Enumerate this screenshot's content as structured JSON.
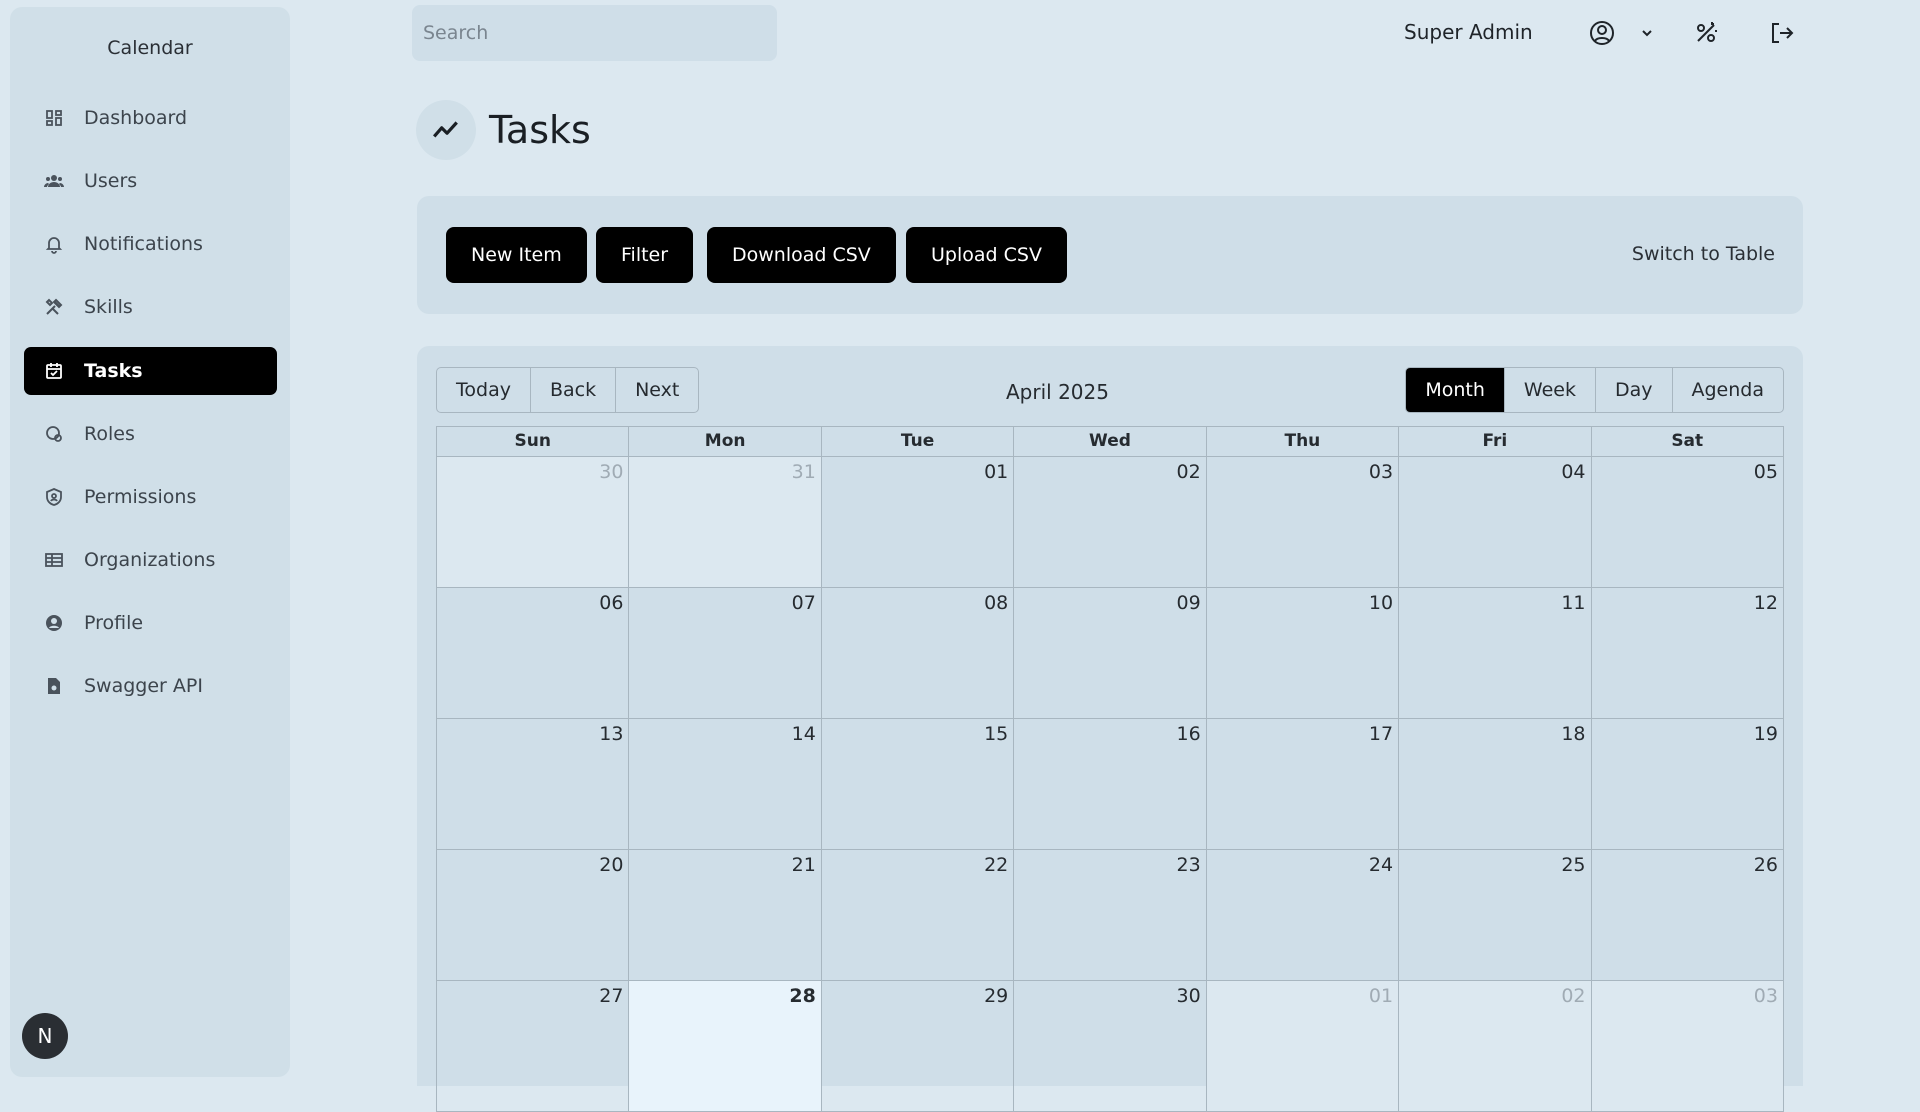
{
  "sidebar": {
    "title": "Calendar",
    "items": [
      {
        "label": "Dashboard",
        "icon": "dashboard-icon"
      },
      {
        "label": "Users",
        "icon": "users-icon"
      },
      {
        "label": "Notifications",
        "icon": "bell-icon"
      },
      {
        "label": "Skills",
        "icon": "tools-icon"
      },
      {
        "label": "Tasks",
        "icon": "calendar-check-icon",
        "active": true
      },
      {
        "label": "Roles",
        "icon": "roles-icon"
      },
      {
        "label": "Permissions",
        "icon": "shield-icon"
      },
      {
        "label": "Organizations",
        "icon": "table-icon"
      },
      {
        "label": "Profile",
        "icon": "user-circle-icon"
      },
      {
        "label": "Swagger API",
        "icon": "file-icon"
      }
    ],
    "avatar_letter": "N"
  },
  "header": {
    "search_placeholder": "Search",
    "user_name": "Super Admin"
  },
  "page": {
    "title": "Tasks"
  },
  "toolbar": {
    "new_item": "New Item",
    "filter": "Filter",
    "download_csv": "Download CSV",
    "upload_csv": "Upload CSV",
    "switch_view": "Switch to Table"
  },
  "calendar": {
    "nav": {
      "today": "Today",
      "back": "Back",
      "next": "Next"
    },
    "label": "April 2025",
    "views": {
      "month": "Month",
      "week": "Week",
      "day": "Day",
      "agenda": "Agenda"
    },
    "active_view": "month",
    "weekdays": [
      "Sun",
      "Mon",
      "Tue",
      "Wed",
      "Thu",
      "Fri",
      "Sat"
    ],
    "weeks": [
      [
        {
          "d": "30",
          "off": true
        },
        {
          "d": "31",
          "off": true
        },
        {
          "d": "01"
        },
        {
          "d": "02"
        },
        {
          "d": "03"
        },
        {
          "d": "04"
        },
        {
          "d": "05"
        }
      ],
      [
        {
          "d": "06"
        },
        {
          "d": "07"
        },
        {
          "d": "08"
        },
        {
          "d": "09"
        },
        {
          "d": "10"
        },
        {
          "d": "11"
        },
        {
          "d": "12"
        }
      ],
      [
        {
          "d": "13"
        },
        {
          "d": "14"
        },
        {
          "d": "15"
        },
        {
          "d": "16"
        },
        {
          "d": "17"
        },
        {
          "d": "18"
        },
        {
          "d": "19"
        }
      ],
      [
        {
          "d": "20"
        },
        {
          "d": "21"
        },
        {
          "d": "22"
        },
        {
          "d": "23"
        },
        {
          "d": "24"
        },
        {
          "d": "25"
        },
        {
          "d": "26"
        }
      ],
      [
        {
          "d": "27"
        },
        {
          "d": "28",
          "today": true
        },
        {
          "d": "29"
        },
        {
          "d": "30"
        },
        {
          "d": "01",
          "off": true
        },
        {
          "d": "02",
          "off": true
        },
        {
          "d": "03",
          "off": true
        }
      ]
    ]
  }
}
